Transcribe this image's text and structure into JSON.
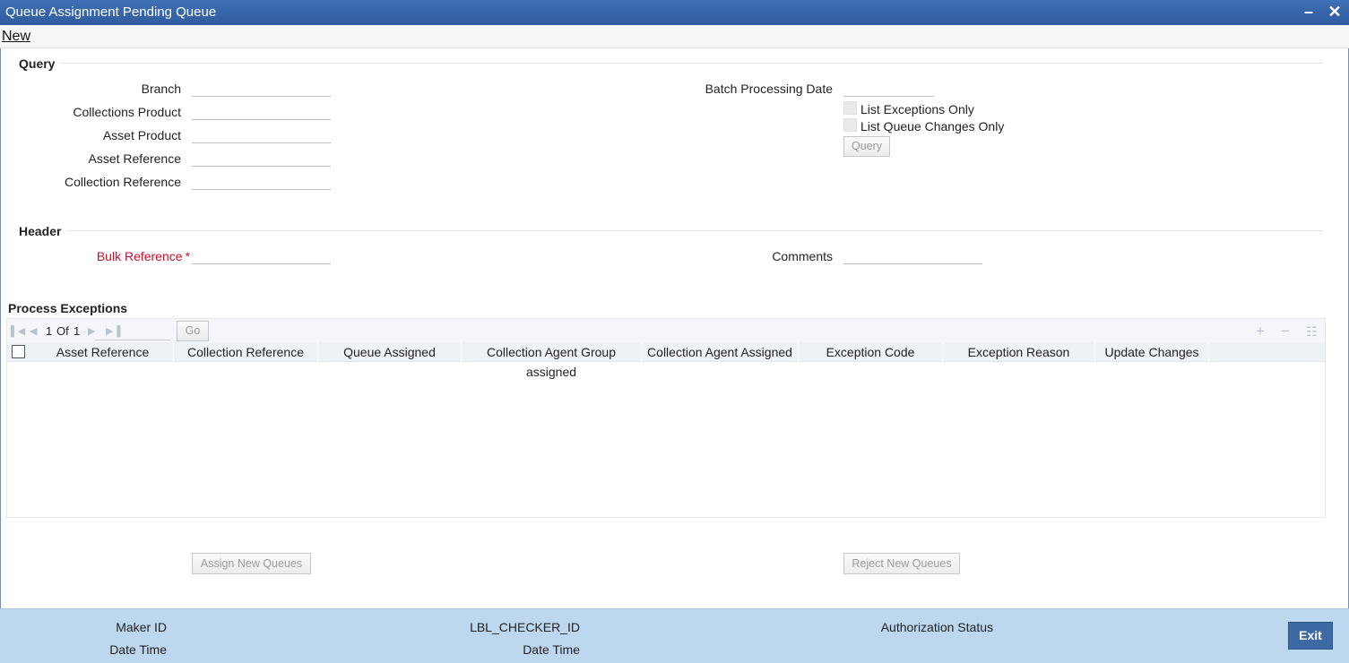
{
  "window": {
    "title": "Queue Assignment Pending Queue",
    "minimize_symbol": "–",
    "close_symbol": "✕"
  },
  "menu": {
    "new_label": "New"
  },
  "query": {
    "title": "Query",
    "branch_label": "Branch",
    "collections_product_label": "Collections Product",
    "asset_product_label": "Asset Product",
    "asset_reference_label": "Asset Reference",
    "collection_reference_label": "Collection Reference",
    "batch_processing_date_label": "Batch Processing Date",
    "list_exceptions_label": "List Exceptions Only",
    "list_queue_changes_label": "List Queue Changes Only",
    "query_button": "Query"
  },
  "header": {
    "title": "Header",
    "bulk_reference_label": "Bulk Reference",
    "required_mark": "*",
    "comments_label": "Comments"
  },
  "process_exceptions": {
    "title": "Process Exceptions",
    "pager": {
      "current": "1",
      "of_label": "Of",
      "total": "1",
      "go_label": "Go"
    },
    "columns": [
      "Asset Reference",
      "Collection Reference",
      "Queue Assigned",
      "Collection Agent Group assigned",
      "Collection Agent Assigned",
      "Exception Code",
      "Exception Reason",
      "Update Changes"
    ],
    "actions": {
      "add": "+",
      "remove": "−",
      "detail": "☷"
    }
  },
  "buttons": {
    "assign_new_queues": "Assign New Queues",
    "reject_new_queues": "Reject New Queues"
  },
  "footer": {
    "maker_id_label": "Maker ID",
    "maker_datetime_label": "Date Time",
    "checker_id_label": "LBL_CHECKER_ID",
    "checker_datetime_label": "Date Time",
    "authorization_status_label": "Authorization Status",
    "exit_label": "Exit"
  }
}
